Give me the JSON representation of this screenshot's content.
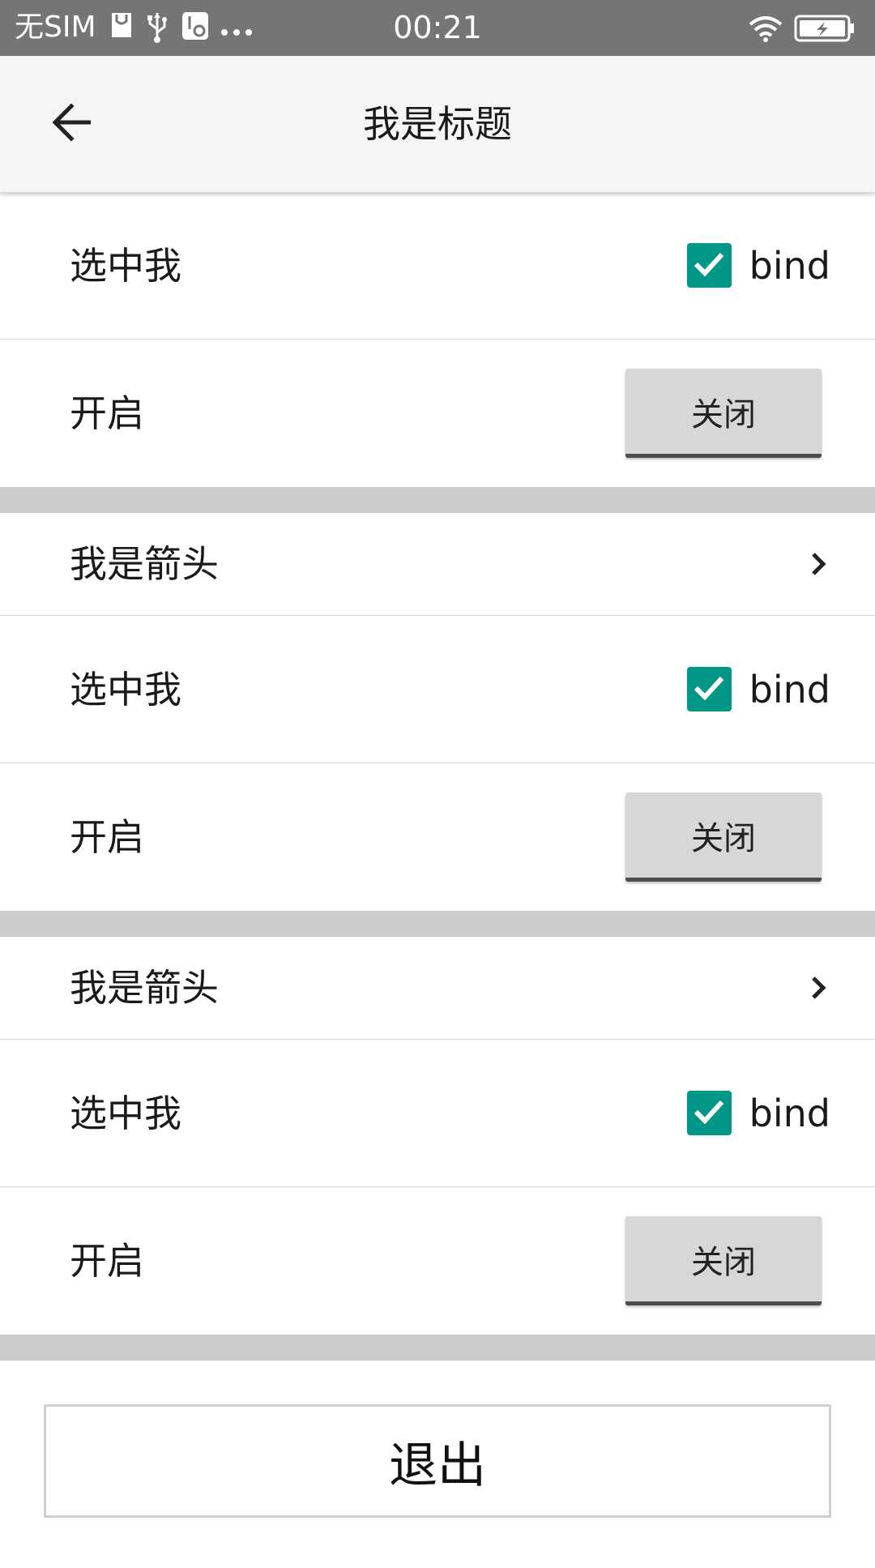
{
  "status_bar": {
    "carrier": "无SIM",
    "time": "00:21",
    "icons": [
      "notification-icon",
      "usb-icon",
      "debug-icon",
      "more-dots-icon",
      "wifi-icon",
      "battery-charging-icon"
    ]
  },
  "app_bar": {
    "title": "我是标题",
    "back_icon": "arrow-back-icon"
  },
  "sections": [
    {
      "checkbox_row": {
        "label": "选中我",
        "checkbox_label": "bind",
        "checked": true
      },
      "toggle_row": {
        "label": "开启",
        "button_label": "关闭"
      }
    },
    {
      "arrow_row": {
        "label": "我是箭头",
        "icon": "chevron-right-icon"
      },
      "checkbox_row": {
        "label": "选中我",
        "checkbox_label": "bind",
        "checked": true
      },
      "toggle_row": {
        "label": "开启",
        "button_label": "关闭"
      }
    },
    {
      "arrow_row": {
        "label": "我是箭头",
        "icon": "chevron-right-icon"
      },
      "checkbox_row": {
        "label": "选中我",
        "checkbox_label": "bind",
        "checked": true
      },
      "toggle_row": {
        "label": "开启",
        "button_label": "关闭"
      }
    }
  ],
  "exit_button": {
    "label": "退出"
  },
  "colors": {
    "status_bar": "#757575",
    "app_bar": "#f5f5f5",
    "checkbox": "#009688",
    "toggle_button": "#d7d7d7",
    "divider": "#cccccc"
  }
}
